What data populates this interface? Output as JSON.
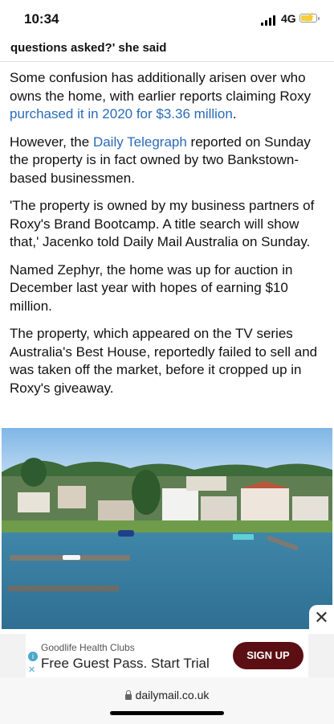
{
  "status_bar": {
    "time": "10:34",
    "network": "4G"
  },
  "headline_bar": {
    "text": "questions asked?' she said"
  },
  "article": {
    "p1_before": "Some confusion has additionally arisen over who owns the home, with earlier reports claiming Roxy ",
    "p1_link": "purchased it in 2020 for $3.36 million",
    "p1_after": ".",
    "p2_before": "However, the ",
    "p2_link": "Daily Telegraph",
    "p2_after": " reported on Sunday the property is in fact owned by two Bankstown-based businessmen.",
    "p3": "'The property is owned by my business partners of Roxy's Brand Bootcamp. A title search will show that,' Jacenko told Daily Mail Australia on Sunday.",
    "p4": "Named Zephyr, the home was up for auction in December last year with hopes of earning $10 million.",
    "p5": "The property, which appeared on the TV series Australia's Best House, reportedly failed to sell and was taken off the market, before it cropped up in Roxy's giveaway."
  },
  "ad": {
    "brand": "Goodlife Health Clubs",
    "headline": "Free Guest Pass. Start Trial",
    "cta": "SIGN UP",
    "close_symbol": "✕",
    "info_symbol": "i",
    "x_symbol": "✕"
  },
  "browser": {
    "url": "dailymail.co.uk"
  },
  "colors": {
    "link": "#2a6bb8",
    "cta_bg": "#5b0f12",
    "water": "#4f8fb0"
  }
}
